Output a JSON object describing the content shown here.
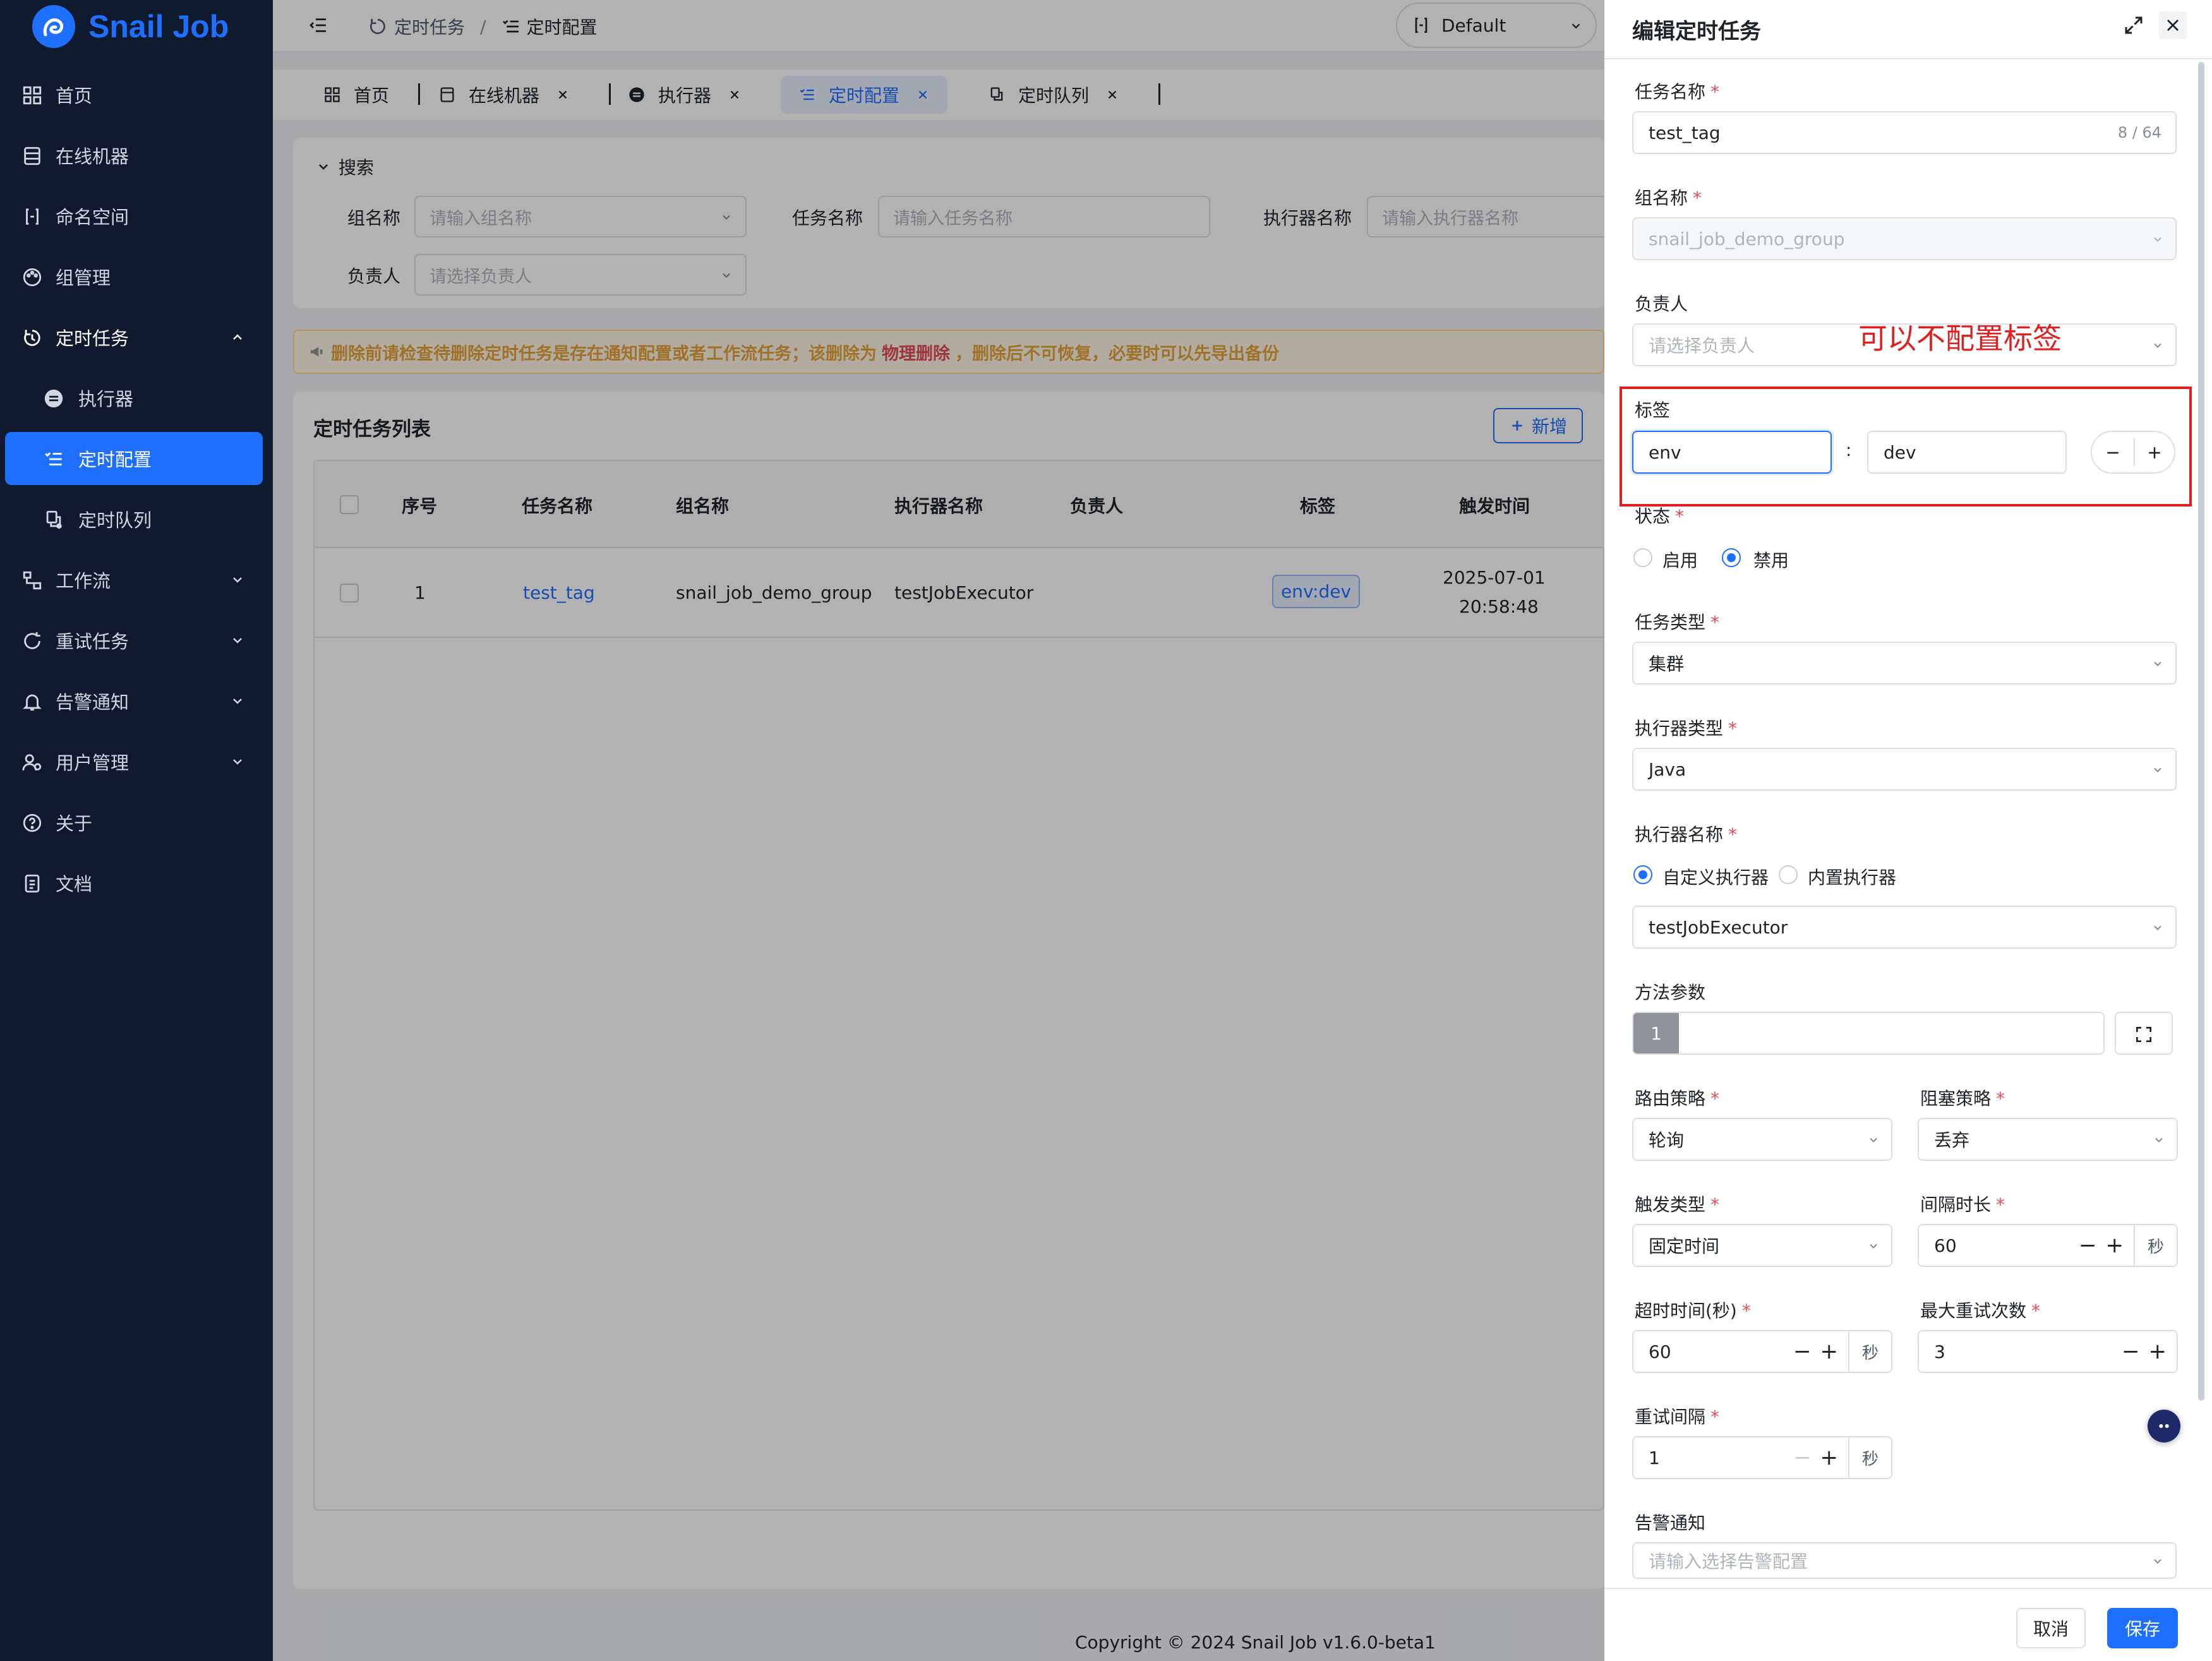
{
  "app": {
    "name": "Snail Job"
  },
  "sidebar": {
    "items": [
      {
        "label": "首页",
        "icon": "dashboard-icon"
      },
      {
        "label": "在线机器",
        "icon": "server-icon"
      },
      {
        "label": "命名空间",
        "icon": "braces-icon"
      },
      {
        "label": "组管理",
        "icon": "palette-icon"
      },
      {
        "label": "定时任务",
        "icon": "timer-icon",
        "expanded": true
      },
      {
        "label": "执行器",
        "icon": "executor-icon"
      },
      {
        "label": "定时配置",
        "icon": "list-check-icon",
        "active": true
      },
      {
        "label": "定时队列",
        "icon": "queue-icon"
      },
      {
        "label": "工作流",
        "icon": "workflow-icon"
      },
      {
        "label": "重试任务",
        "icon": "retry-icon"
      },
      {
        "label": "告警通知",
        "icon": "bell-icon"
      },
      {
        "label": "用户管理",
        "icon": "users-icon"
      },
      {
        "label": "关于",
        "icon": "help-icon"
      },
      {
        "label": "文档",
        "icon": "doc-icon"
      }
    ]
  },
  "header": {
    "breadcrumb": [
      "定时任务",
      "定时配置"
    ],
    "namespace": "Default"
  },
  "tabs": [
    {
      "label": "首页"
    },
    {
      "label": "在线机器"
    },
    {
      "label": "执行器"
    },
    {
      "label": "定时配置",
      "active": true
    },
    {
      "label": "定时队列"
    }
  ],
  "search": {
    "title": "搜索",
    "group_label": "组名称",
    "group_placeholder": "请输入组名称",
    "job_label": "任务名称",
    "job_placeholder": "请输入任务名称",
    "executor_label": "执行器名称",
    "executor_placeholder": "请输入执行器名称",
    "owner_label": "负责人",
    "owner_placeholder": "请选择负责人"
  },
  "warning": {
    "text_before": "删除前请检查待删除定时任务是存在通知配置或者工作流任务；该删除为",
    "text_strong": "物理删除",
    "text_after": "，删除后不可恢复，必要时可以先导出备份"
  },
  "table": {
    "title": "定时任务列表",
    "add_label": "新增",
    "columns": [
      "序号",
      "任务名称",
      "组名称",
      "执行器名称",
      "负责人",
      "标签",
      "触发时间"
    ],
    "rows": [
      {
        "index": "1",
        "name": "test_tag",
        "group": "snail_job_demo_group",
        "executor": "testJobExecutor",
        "owner": "",
        "tag": "env:dev",
        "trigger_date": "2025-07-01",
        "trigger_time": "20:58:48"
      }
    ]
  },
  "footer": {
    "copyright": "Copyright © 2024 Snail Job v1.6.0-beta1"
  },
  "drawer": {
    "title": "编辑定时任务",
    "annotation": "可以不配置标签",
    "fields": {
      "job_name": {
        "label": "任务名称",
        "value": "test_tag",
        "counter": "8 / 64"
      },
      "group_name": {
        "label": "组名称",
        "value": "snail_job_demo_group"
      },
      "owner": {
        "label": "负责人",
        "placeholder": "请选择负责人"
      },
      "tags": {
        "label": "标签",
        "key": "env",
        "separator": ":",
        "value": "dev"
      },
      "status": {
        "label": "状态",
        "options": [
          "启用",
          "禁用"
        ],
        "selected": "禁用"
      },
      "task_type": {
        "label": "任务类型",
        "value": "集群"
      },
      "executor_type": {
        "label": "执行器类型",
        "value": "Java"
      },
      "executor_name": {
        "label": "执行器名称",
        "options": [
          "自定义执行器",
          "内置执行器"
        ],
        "selected": "自定义执行器",
        "value": "testJobExecutor"
      },
      "method_params": {
        "label": "方法参数",
        "line_number": "1"
      },
      "route_strategy": {
        "label": "路由策略",
        "value": "轮询"
      },
      "block_strategy": {
        "label": "阻塞策略",
        "value": "丢弃"
      },
      "trigger_type": {
        "label": "触发类型",
        "value": "固定时间"
      },
      "interval": {
        "label": "间隔时长",
        "value": "60",
        "unit": "秒"
      },
      "timeout": {
        "label": "超时时间(秒)",
        "value": "60",
        "unit": "秒"
      },
      "max_retry": {
        "label": "最大重试次数",
        "value": "3"
      },
      "retry_interval": {
        "label": "重试间隔",
        "value": "1",
        "unit": "秒"
      },
      "alarm": {
        "label": "告警通知",
        "placeholder": "请输入选择告警配置"
      }
    },
    "buttons": {
      "cancel": "取消",
      "save": "保存"
    }
  },
  "colors": {
    "primary": "#1f6fff",
    "sidebar": "#0f1a2e",
    "danger": "#e34d59",
    "warning_bg": "#fff7e6",
    "warning_text": "#e6a23c",
    "annotation": "#e02020"
  }
}
